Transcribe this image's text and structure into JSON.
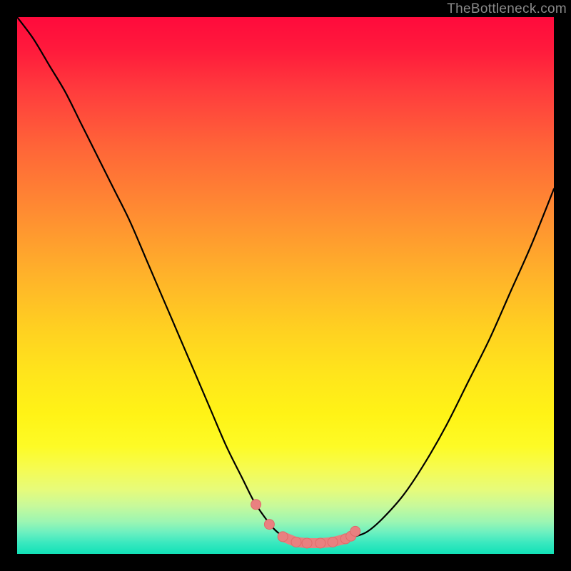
{
  "watermark": "TheBottleneck.com",
  "colors": {
    "frame": "#000000",
    "curve": "#000000",
    "marker": "#e98080",
    "gradient_top": "#ff0a3c",
    "gradient_bottom": "#12e2b7"
  },
  "chart_data": {
    "type": "line",
    "title": "",
    "xlabel": "",
    "ylabel": "",
    "xlim": [
      0,
      100
    ],
    "ylim": [
      0,
      100
    ],
    "x": [
      0,
      3,
      6,
      9,
      12,
      15,
      18,
      21,
      24,
      27,
      30,
      33,
      36,
      39,
      42,
      44,
      46,
      48,
      50,
      52,
      54,
      56,
      58,
      60,
      62,
      65,
      68,
      72,
      76,
      80,
      84,
      88,
      92,
      96,
      100
    ],
    "values": [
      100,
      96,
      91,
      86,
      80,
      74,
      68,
      62,
      55,
      48,
      41,
      34,
      27,
      20,
      14,
      10,
      7,
      4.5,
      3,
      2.2,
      2,
      2,
      2.1,
      2.3,
      3,
      4,
      6.5,
      11,
      17,
      24,
      32,
      40,
      49,
      58,
      68
    ],
    "markers": {
      "x": [
        44.5,
        47.0,
        49.5,
        52.0,
        54.0,
        56.5,
        58.8,
        61.2,
        62.2,
        63.0
      ],
      "y": [
        9.2,
        5.5,
        3.2,
        2.2,
        2.0,
        2.0,
        2.2,
        2.8,
        3.3,
        4.2
      ]
    },
    "annotations": []
  }
}
